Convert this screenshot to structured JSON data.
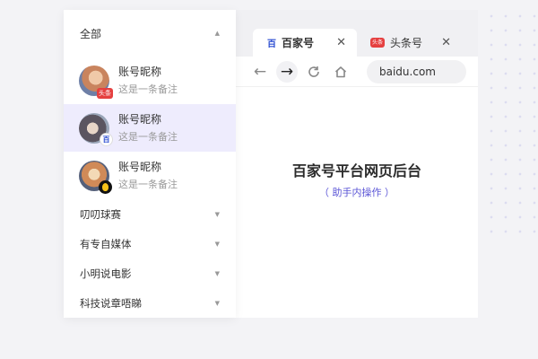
{
  "accounts_panel": {
    "header_label": "全部",
    "accounts": [
      {
        "name": "账号昵称",
        "note": "这是一条备注",
        "platform_badge": "头条",
        "active": false
      },
      {
        "name": "账号昵称",
        "note": "这是一条备注",
        "platform_badge": "百",
        "active": true
      },
      {
        "name": "账号昵称",
        "note": "这是一条备注",
        "platform_badge": "",
        "active": false
      }
    ],
    "groups": [
      "叨叨球赛",
      "有专自媒体",
      "小明说电影",
      "科技说章唔睇"
    ]
  },
  "browser": {
    "tabs": [
      {
        "favicon": "百",
        "title": "百家号",
        "close": "✕"
      },
      {
        "favicon": "头条",
        "title": "头条号",
        "close": "✕"
      }
    ],
    "nav": {
      "back": "←",
      "forward": "→"
    },
    "address": "baidu.com",
    "page_title": "百家号平台网页后台",
    "page_subtitle": "（ 助手内操作 ）"
  },
  "icons": {
    "caret_up": "▲",
    "caret_down": "▼"
  },
  "colors": {
    "accent": "#5b55d6",
    "active_row_bg": "#eeecfd",
    "toutiao_red": "#e54040"
  }
}
